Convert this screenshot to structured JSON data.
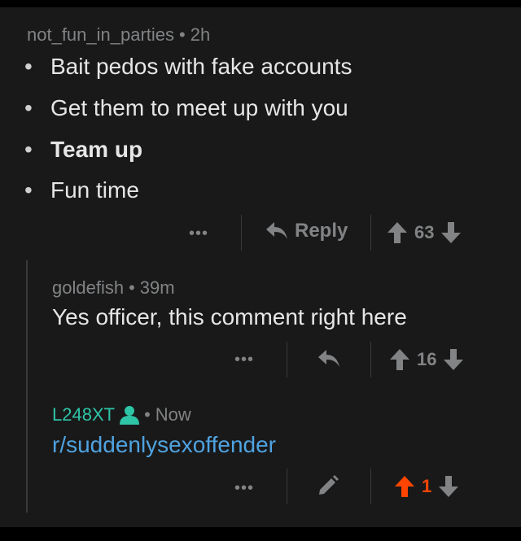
{
  "comment1": {
    "author": "not_fun_in_parties",
    "separator": "•",
    "time": "2h",
    "bullets": [
      "Bait pedos with fake accounts",
      "Get them to meet up with you",
      "Team up",
      "Fun time"
    ],
    "bullet_char": "•",
    "more": "•••",
    "reply_label": "Reply",
    "score": "63"
  },
  "comment2": {
    "author": "goldefish",
    "separator": "•",
    "time": "39m",
    "body": "Yes officer, this comment right here",
    "more": "•••",
    "score": "16"
  },
  "comment3": {
    "author": "L248XT",
    "separator": "•",
    "time": "Now",
    "body": "r/suddenlysexoffender",
    "more": "•••",
    "score": "1"
  },
  "colors": {
    "background": "#19191a",
    "upvoted": "#ff4500",
    "op_user": "#2ec4a6",
    "link": "#4fa3e0",
    "muted": "#818384"
  },
  "icons": [
    "reply-arrow-icon",
    "upvote-arrow-icon",
    "downvote-arrow-icon",
    "user-icon",
    "pencil-icon"
  ]
}
